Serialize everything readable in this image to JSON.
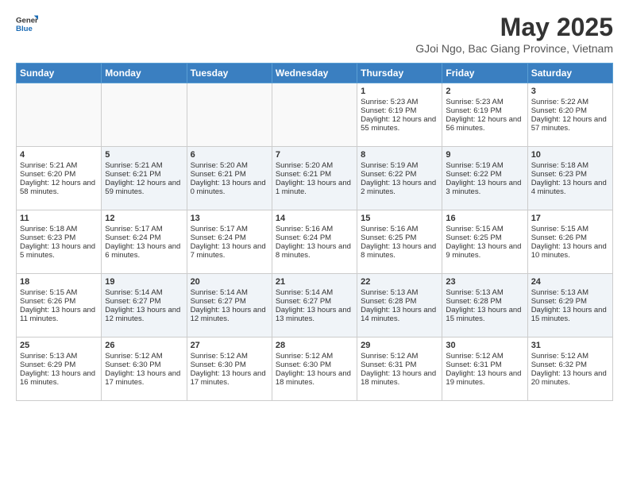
{
  "header": {
    "logo_general": "General",
    "logo_blue": "Blue",
    "month_title": "May 2025",
    "subtitle": "GJoi Ngo, Bac Giang Province, Vietnam"
  },
  "days_of_week": [
    "Sunday",
    "Monday",
    "Tuesday",
    "Wednesday",
    "Thursday",
    "Friday",
    "Saturday"
  ],
  "weeks": [
    [
      {
        "day": "",
        "content": ""
      },
      {
        "day": "",
        "content": ""
      },
      {
        "day": "",
        "content": ""
      },
      {
        "day": "",
        "content": ""
      },
      {
        "day": "1",
        "content": "Sunrise: 5:23 AM\nSunset: 6:19 PM\nDaylight: 12 hours and 55 minutes."
      },
      {
        "day": "2",
        "content": "Sunrise: 5:23 AM\nSunset: 6:19 PM\nDaylight: 12 hours and 56 minutes."
      },
      {
        "day": "3",
        "content": "Sunrise: 5:22 AM\nSunset: 6:20 PM\nDaylight: 12 hours and 57 minutes."
      }
    ],
    [
      {
        "day": "4",
        "content": "Sunrise: 5:21 AM\nSunset: 6:20 PM\nDaylight: 12 hours and 58 minutes."
      },
      {
        "day": "5",
        "content": "Sunrise: 5:21 AM\nSunset: 6:21 PM\nDaylight: 12 hours and 59 minutes."
      },
      {
        "day": "6",
        "content": "Sunrise: 5:20 AM\nSunset: 6:21 PM\nDaylight: 13 hours and 0 minutes."
      },
      {
        "day": "7",
        "content": "Sunrise: 5:20 AM\nSunset: 6:21 PM\nDaylight: 13 hours and 1 minute."
      },
      {
        "day": "8",
        "content": "Sunrise: 5:19 AM\nSunset: 6:22 PM\nDaylight: 13 hours and 2 minutes."
      },
      {
        "day": "9",
        "content": "Sunrise: 5:19 AM\nSunset: 6:22 PM\nDaylight: 13 hours and 3 minutes."
      },
      {
        "day": "10",
        "content": "Sunrise: 5:18 AM\nSunset: 6:23 PM\nDaylight: 13 hours and 4 minutes."
      }
    ],
    [
      {
        "day": "11",
        "content": "Sunrise: 5:18 AM\nSunset: 6:23 PM\nDaylight: 13 hours and 5 minutes."
      },
      {
        "day": "12",
        "content": "Sunrise: 5:17 AM\nSunset: 6:24 PM\nDaylight: 13 hours and 6 minutes."
      },
      {
        "day": "13",
        "content": "Sunrise: 5:17 AM\nSunset: 6:24 PM\nDaylight: 13 hours and 7 minutes."
      },
      {
        "day": "14",
        "content": "Sunrise: 5:16 AM\nSunset: 6:24 PM\nDaylight: 13 hours and 8 minutes."
      },
      {
        "day": "15",
        "content": "Sunrise: 5:16 AM\nSunset: 6:25 PM\nDaylight: 13 hours and 8 minutes."
      },
      {
        "day": "16",
        "content": "Sunrise: 5:15 AM\nSunset: 6:25 PM\nDaylight: 13 hours and 9 minutes."
      },
      {
        "day": "17",
        "content": "Sunrise: 5:15 AM\nSunset: 6:26 PM\nDaylight: 13 hours and 10 minutes."
      }
    ],
    [
      {
        "day": "18",
        "content": "Sunrise: 5:15 AM\nSunset: 6:26 PM\nDaylight: 13 hours and 11 minutes."
      },
      {
        "day": "19",
        "content": "Sunrise: 5:14 AM\nSunset: 6:27 PM\nDaylight: 13 hours and 12 minutes."
      },
      {
        "day": "20",
        "content": "Sunrise: 5:14 AM\nSunset: 6:27 PM\nDaylight: 13 hours and 12 minutes."
      },
      {
        "day": "21",
        "content": "Sunrise: 5:14 AM\nSunset: 6:27 PM\nDaylight: 13 hours and 13 minutes."
      },
      {
        "day": "22",
        "content": "Sunrise: 5:13 AM\nSunset: 6:28 PM\nDaylight: 13 hours and 14 minutes."
      },
      {
        "day": "23",
        "content": "Sunrise: 5:13 AM\nSunset: 6:28 PM\nDaylight: 13 hours and 15 minutes."
      },
      {
        "day": "24",
        "content": "Sunrise: 5:13 AM\nSunset: 6:29 PM\nDaylight: 13 hours and 15 minutes."
      }
    ],
    [
      {
        "day": "25",
        "content": "Sunrise: 5:13 AM\nSunset: 6:29 PM\nDaylight: 13 hours and 16 minutes."
      },
      {
        "day": "26",
        "content": "Sunrise: 5:12 AM\nSunset: 6:30 PM\nDaylight: 13 hours and 17 minutes."
      },
      {
        "day": "27",
        "content": "Sunrise: 5:12 AM\nSunset: 6:30 PM\nDaylight: 13 hours and 17 minutes."
      },
      {
        "day": "28",
        "content": "Sunrise: 5:12 AM\nSunset: 6:30 PM\nDaylight: 13 hours and 18 minutes."
      },
      {
        "day": "29",
        "content": "Sunrise: 5:12 AM\nSunset: 6:31 PM\nDaylight: 13 hours and 18 minutes."
      },
      {
        "day": "30",
        "content": "Sunrise: 5:12 AM\nSunset: 6:31 PM\nDaylight: 13 hours and 19 minutes."
      },
      {
        "day": "31",
        "content": "Sunrise: 5:12 AM\nSunset: 6:32 PM\nDaylight: 13 hours and 20 minutes."
      }
    ]
  ]
}
